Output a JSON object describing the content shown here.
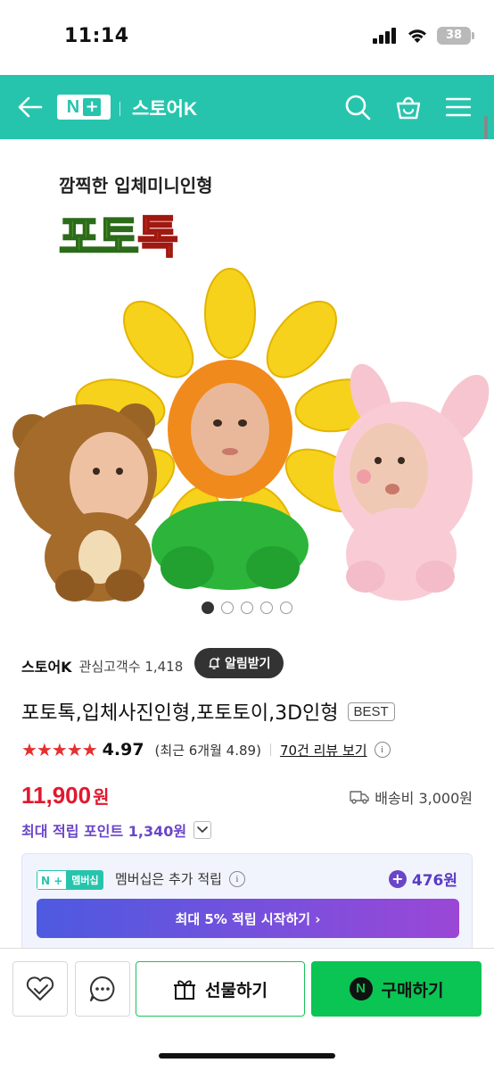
{
  "status_bar": {
    "time": "11:14",
    "battery": "38"
  },
  "header": {
    "brand_n": "N",
    "brand_plus": "+",
    "store_title": "스토어K"
  },
  "product_image": {
    "caption": "깜찍한 입체미니인형",
    "logo_part1": "포토",
    "logo_part2": "톡",
    "slide_count": 5,
    "active_slide": 1
  },
  "store": {
    "name": "스토어K",
    "fans_label": "관심고객수 1,418",
    "alarm_label": "알림받기"
  },
  "product": {
    "title": "포토톡,입체사진인형,포토토이,3D인형",
    "badge": "BEST",
    "stars": "★★★★★",
    "rating": "4.97",
    "recent_rating": "(최근 6개월 4.89)",
    "review_link": "70건 리뷰 보기",
    "price": "11,900",
    "price_unit": "원",
    "shipping": "배송비 3,000원",
    "points_label": "최대 적립 포인트 1,340원"
  },
  "membership": {
    "badge_np": "N +",
    "badge_label": "멤버십",
    "text": "멤버십은 추가 적립",
    "points": "476원",
    "cta": "최대 5% 적립 시작하기 ›"
  },
  "bottom_bar": {
    "gift_label": "선물하기",
    "buy_n": "N",
    "buy_label": "구매하기"
  },
  "colors": {
    "header_bg": "#27c4ad",
    "price": "#e0192f",
    "points": "#6a45c8",
    "buy_button": "#0ac454"
  }
}
